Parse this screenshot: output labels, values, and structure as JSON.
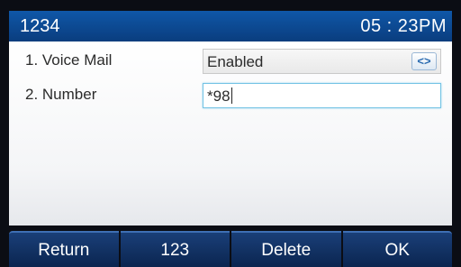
{
  "status_bar": {
    "account": "1234",
    "time": "05 : 23PM"
  },
  "fields": [
    {
      "index_label": "1. Voice Mail",
      "value": "Enabled",
      "switch_glyph": "<>"
    },
    {
      "index_label": "2. Number",
      "value": "*98"
    }
  ],
  "softkeys": [
    "Return",
    "123",
    "Delete",
    "OK"
  ],
  "colors": {
    "status_bar": "#0f57a8",
    "softkey": "#163b72",
    "input_focus_border": "#73c3e4"
  }
}
